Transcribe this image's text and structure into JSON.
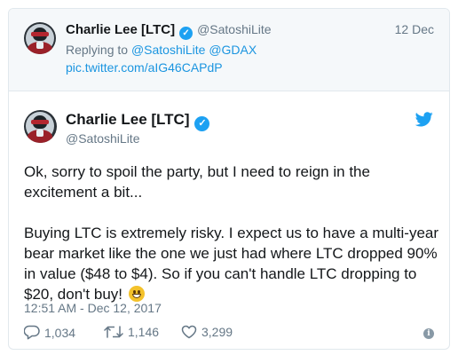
{
  "parent_tweet": {
    "name": "Charlie Lee [LTC]",
    "handle": "@SatoshiLite",
    "date": "12 Dec",
    "replying_prefix": "Replying to",
    "replying_to": [
      "@SatoshiLite",
      "@GDAX"
    ],
    "link": "pic.twitter.com/aIG46CAPdP",
    "verified_icon": "verified-badge-icon",
    "avatar": "avatar-image"
  },
  "main_tweet": {
    "name": "Charlie Lee [LTC]",
    "handle": "@SatoshiLite",
    "paragraph1": "Ok, sorry to spoil the party, but I need to reign in the excitement a bit...",
    "paragraph2": "Buying LTC is extremely risky. I expect us to have a multi-year bear market like the one we just had where LTC dropped 90% in value ($48 to $4). So if you can't handle LTC dropping to $20, don't buy!",
    "emoji": "grinning-face-emoji",
    "timestamp": "12:51 AM - Dec 12, 2017",
    "replies": "1,034",
    "retweets": "1,146",
    "likes": "3,299",
    "verified_icon": "verified-badge-icon",
    "brand_icon": "twitter-bird-icon"
  },
  "colors": {
    "accent": "#1da1f2",
    "link": "#1b95e0",
    "muted": "#657786",
    "border": "#e1e8ed",
    "parent_bg": "#f5f8fa"
  }
}
